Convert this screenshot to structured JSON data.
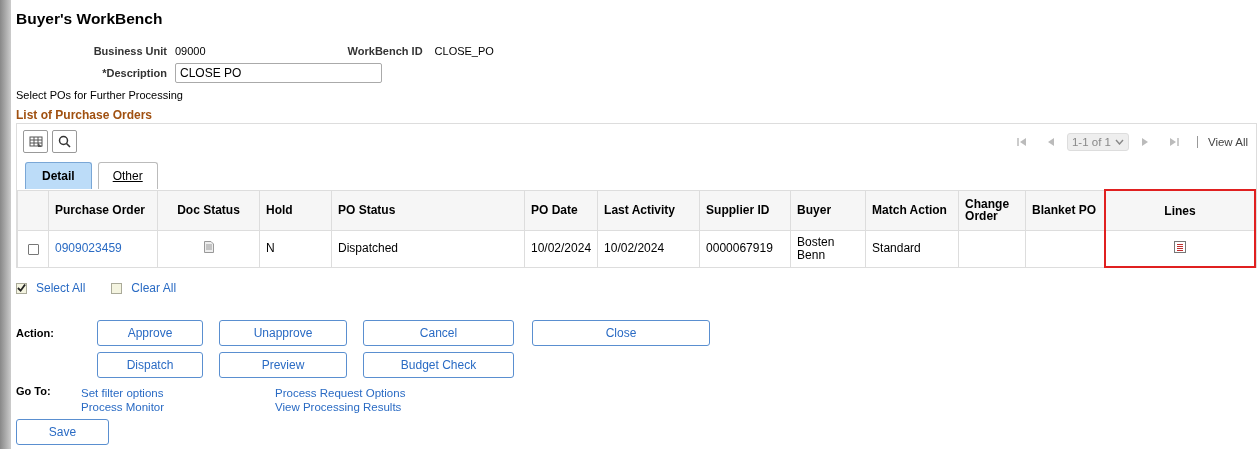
{
  "title": "Buyer's WorkBench",
  "fields": {
    "business_unit": {
      "label": "Business Unit",
      "value": "09000"
    },
    "workbench_id": {
      "label": "WorkBench ID",
      "value": "CLOSE_PO"
    },
    "description": {
      "label": "*Description",
      "value": "CLOSE PO"
    }
  },
  "instruction": "Select POs for Further Processing",
  "grid": {
    "title": "List of Purchase Orders",
    "pager": {
      "range": "1-1 of 1",
      "view_all": "View All"
    },
    "tabs": [
      {
        "label": "Detail",
        "selected": true
      },
      {
        "label": "Other",
        "selected": false
      }
    ],
    "columns": [
      {
        "kind": "select",
        "highlighted": false
      },
      {
        "label": "Purchase Order",
        "kind": "link",
        "highlighted": false
      },
      {
        "label": "Doc Status",
        "kind": "doc-icon",
        "highlighted": false
      },
      {
        "label": "Hold",
        "kind": "text",
        "highlighted": false
      },
      {
        "label": "PO Status",
        "kind": "text",
        "highlighted": false
      },
      {
        "label": "PO Date",
        "kind": "text",
        "highlighted": false
      },
      {
        "label": "Last Activity",
        "kind": "text",
        "highlighted": false
      },
      {
        "label": "Supplier ID",
        "kind": "text",
        "highlighted": false
      },
      {
        "label": "Buyer",
        "kind": "text",
        "highlighted": false
      },
      {
        "label": "Match Action",
        "kind": "text",
        "highlighted": false
      },
      {
        "label": "Change Order",
        "kind": "text",
        "highlighted": false
      },
      {
        "label": "Blanket PO",
        "kind": "text",
        "highlighted": false
      },
      {
        "label": "Lines",
        "kind": "lines-icon",
        "highlighted": true
      }
    ],
    "rows": [
      {
        "checked": false,
        "cells": [
          "",
          "0909023459",
          "",
          "N",
          "Dispatched",
          "10/02/2024",
          "10/02/2024",
          "0000067919",
          "Bosten Benn",
          "Standard",
          "",
          "",
          ""
        ]
      }
    ]
  },
  "select_all": {
    "label": "Select All",
    "checked": true
  },
  "clear_all": {
    "label": "Clear All",
    "checked": false
  },
  "action_label": "Action:",
  "actions": [
    [
      "Approve",
      "Unapprove",
      "Cancel",
      "Close"
    ],
    [
      "Dispatch",
      "Preview",
      "Budget Check"
    ]
  ],
  "goto_label": "Go To:",
  "goto_links": [
    [
      "Set filter options",
      "Process Monitor"
    ],
    [
      "Process Request Options",
      "View Processing Results"
    ]
  ],
  "save": "Save"
}
